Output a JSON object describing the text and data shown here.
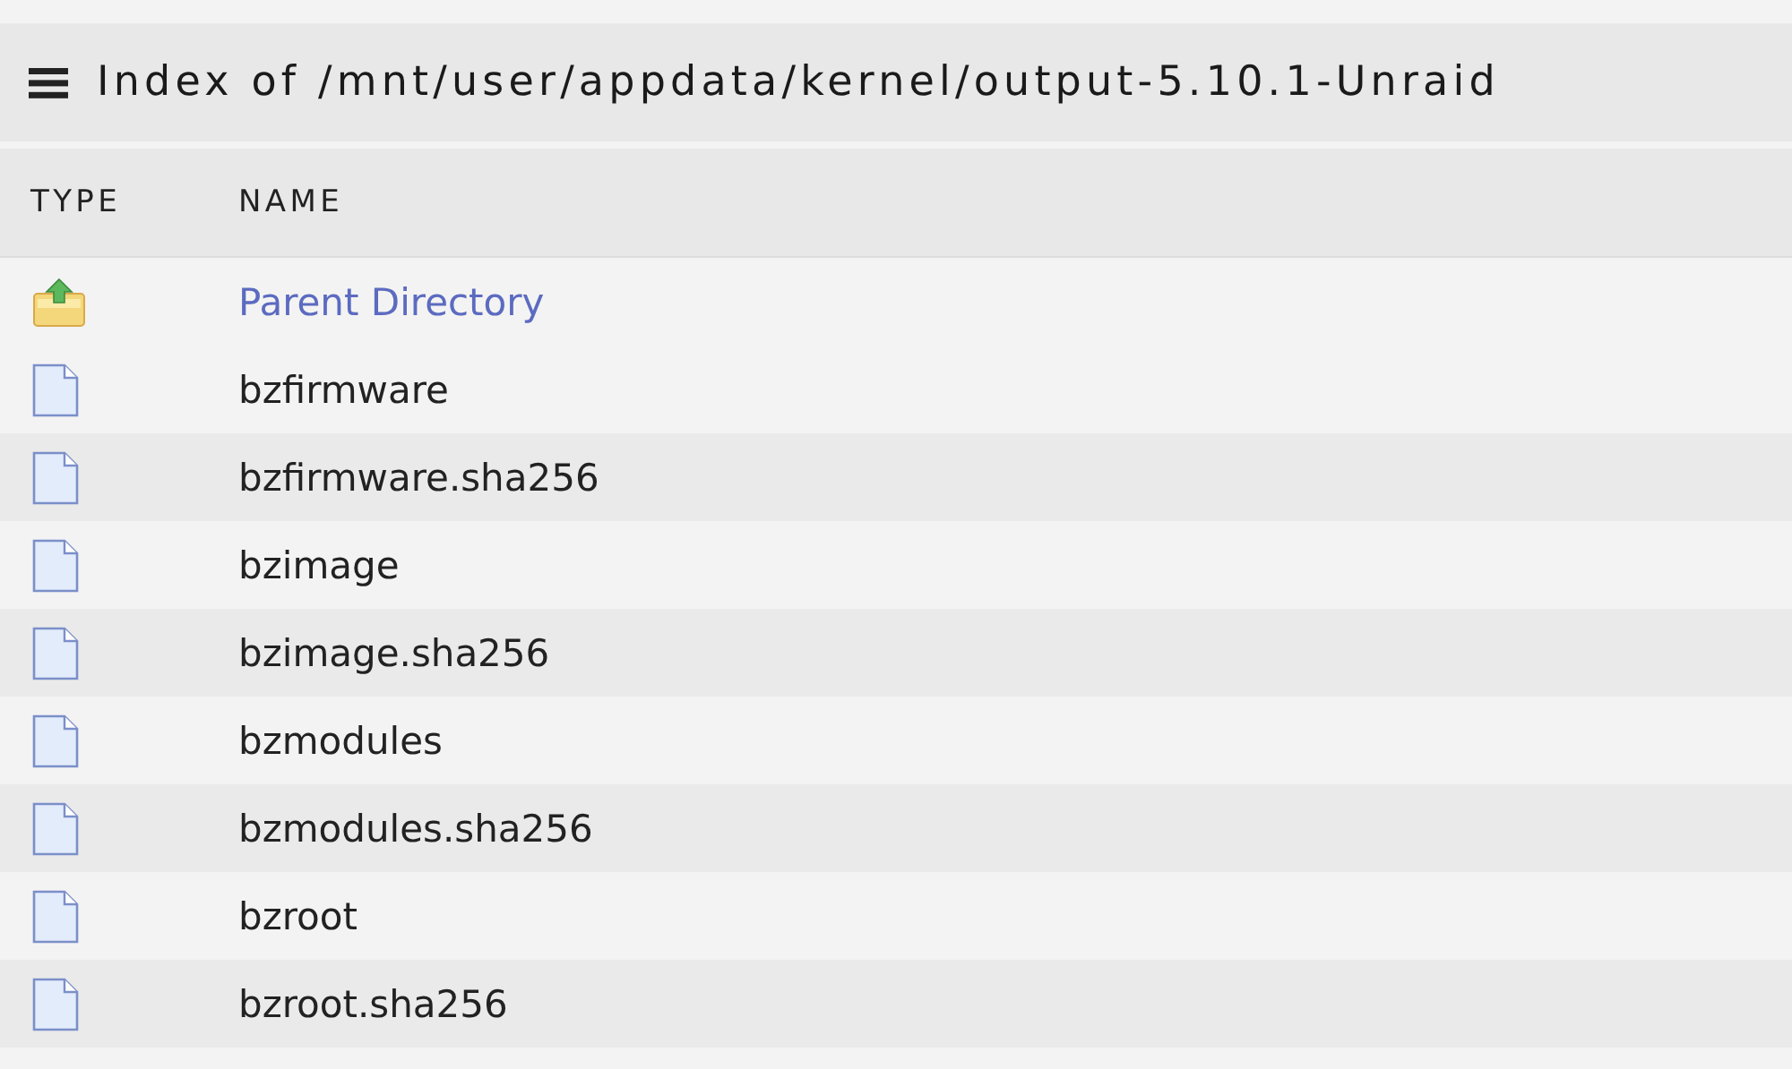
{
  "title": "Index of /mnt/user/appdata/kernel/output-5.10.1-Unraid",
  "table": {
    "columns": [
      "TYPE",
      "NAME"
    ],
    "rows": [
      {
        "kind": "parent",
        "name": "Parent Directory"
      },
      {
        "kind": "file",
        "name": "bzfirmware"
      },
      {
        "kind": "file",
        "name": "bzfirmware.sha256"
      },
      {
        "kind": "file",
        "name": "bzimage"
      },
      {
        "kind": "file",
        "name": "bzimage.sha256"
      },
      {
        "kind": "file",
        "name": "bzmodules"
      },
      {
        "kind": "file",
        "name": "bzmodules.sha256"
      },
      {
        "kind": "file",
        "name": "bzroot"
      },
      {
        "kind": "file",
        "name": "bzroot.sha256"
      }
    ]
  }
}
